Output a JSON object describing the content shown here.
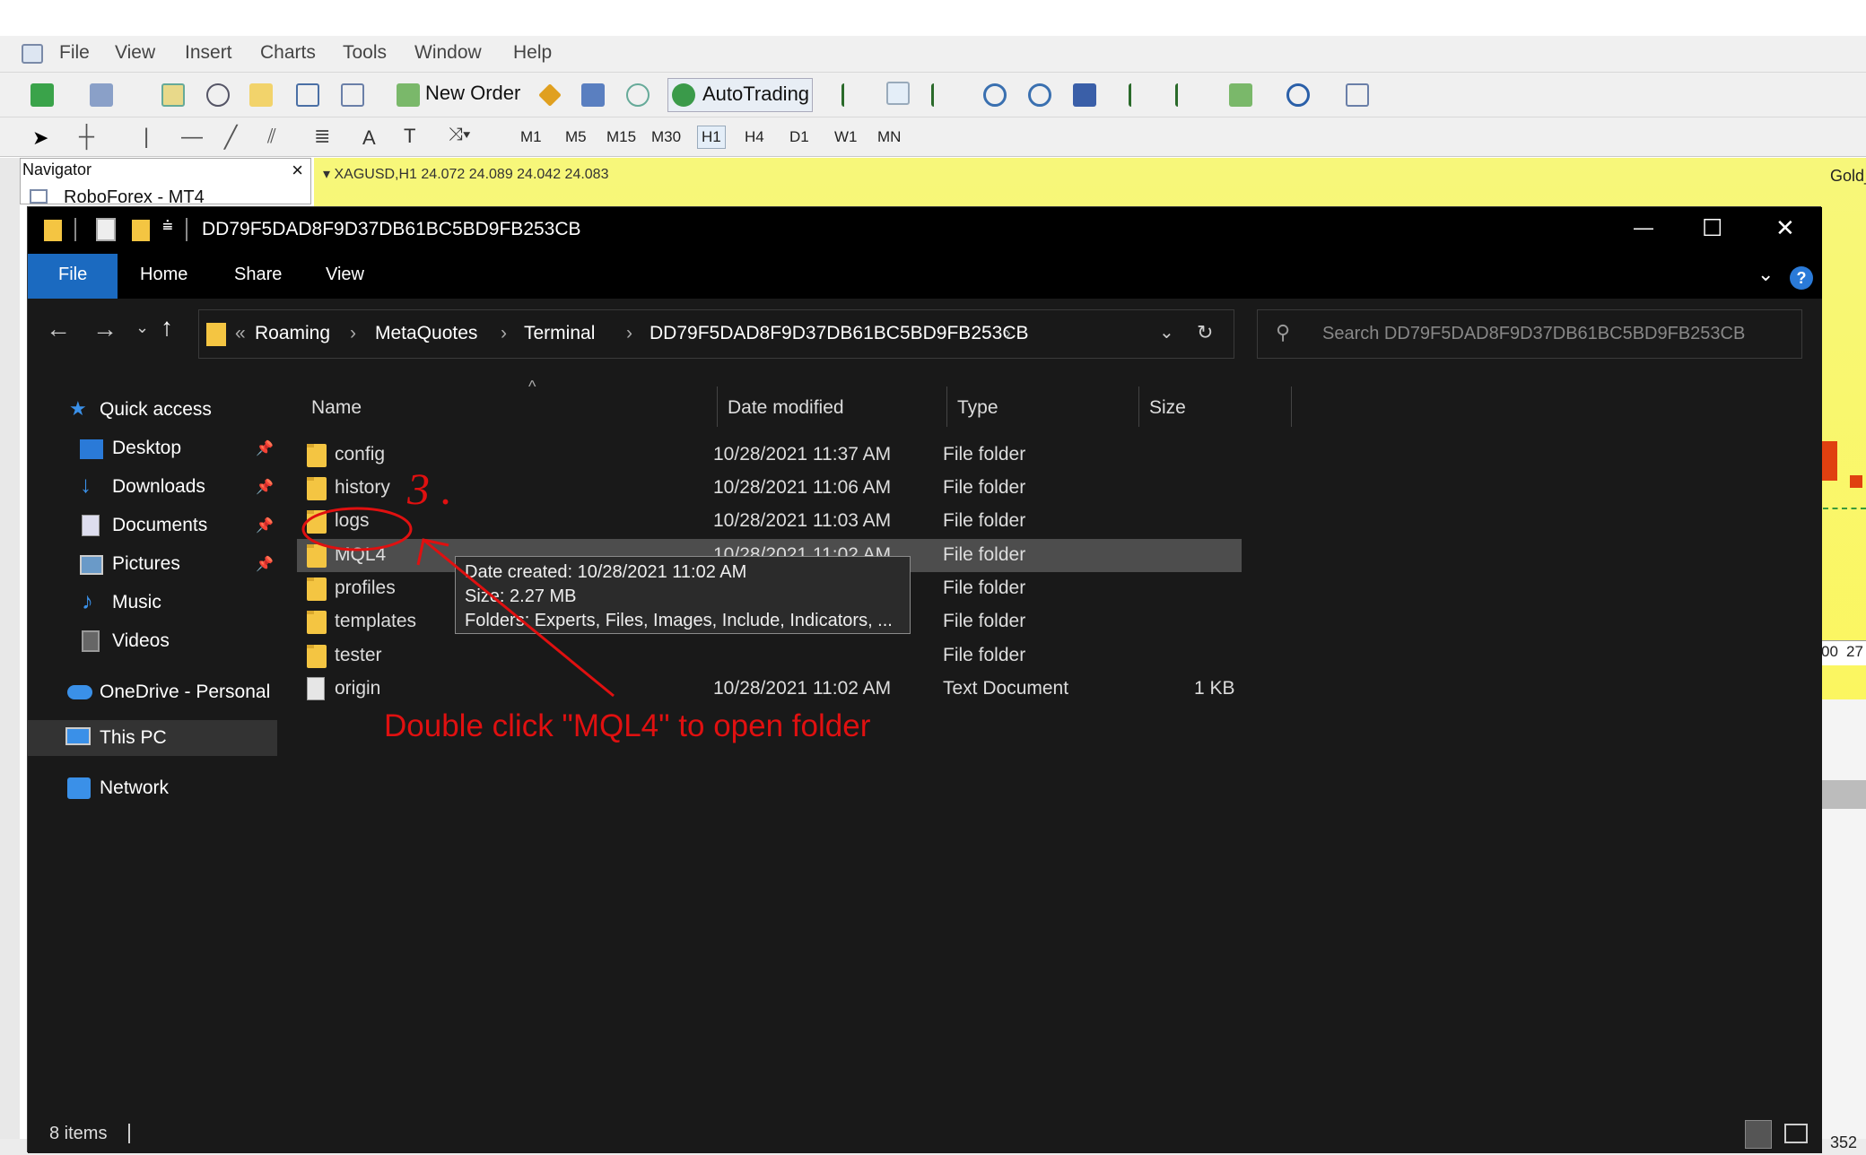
{
  "mt4": {
    "menu": [
      "File",
      "View",
      "Insert",
      "Charts",
      "Tools",
      "Window",
      "Help"
    ],
    "toolbar": {
      "new_order": "New Order",
      "autotrading": "AutoTrading"
    },
    "timeframes": [
      "M1",
      "M5",
      "M15",
      "M30",
      "H1",
      "H4",
      "D1",
      "W1",
      "MN"
    ],
    "selected_timeframe": "H1",
    "navigator": {
      "title": "Navigator",
      "close": "×",
      "item": "RoboForex - MT4"
    },
    "chart_header": "▾ XAGUSD,H1  24.072 24.089 24.042 24.083",
    "chart_symbol_right": "Gold_",
    "right_axis_values": [
      "00",
      "27"
    ],
    "bottom_right_value": "352",
    "colors": {
      "chart_bg": "#fff64a"
    }
  },
  "explorer": {
    "title": "DD79F5DAD8F9D37DB61BC5BD9FB253CB",
    "window_controls": {
      "minimize": "—",
      "maximize": "☐",
      "close": "✕"
    },
    "ribbon_tabs": [
      "File",
      "Home",
      "Share",
      "View"
    ],
    "breadcrumb": [
      "«",
      "Roaming",
      "MetaQuotes",
      "Terminal",
      "DD79F5DAD8F9D37DB61BC5BD9FB253CB"
    ],
    "search_placeholder": "Search DD79F5DAD8F9D37DB61BC5BD9FB253CB",
    "sidebar": [
      {
        "label": "Quick access",
        "icon": "star-icon",
        "pinned": false
      },
      {
        "label": "Desktop",
        "icon": "desktop-icon",
        "pinned": true
      },
      {
        "label": "Downloads",
        "icon": "download-arrow-icon",
        "pinned": true
      },
      {
        "label": "Documents",
        "icon": "documents-icon",
        "pinned": true
      },
      {
        "label": "Pictures",
        "icon": "pictures-icon",
        "pinned": true
      },
      {
        "label": "Music",
        "icon": "music-note-icon",
        "pinned": false
      },
      {
        "label": "Videos",
        "icon": "videos-icon",
        "pinned": false
      },
      {
        "label": "OneDrive - Personal",
        "icon": "cloud-icon",
        "pinned": false
      },
      {
        "label": "This PC",
        "icon": "computer-icon",
        "pinned": false,
        "selected": true
      },
      {
        "label": "Network",
        "icon": "network-icon",
        "pinned": false
      }
    ],
    "columns": [
      "Name",
      "Date modified",
      "Type",
      "Size"
    ],
    "files": [
      {
        "name": "config",
        "date": "10/28/2021 11:37 AM",
        "type": "File folder",
        "size": "",
        "kind": "folder"
      },
      {
        "name": "history",
        "date": "10/28/2021 11:06 AM",
        "type": "File folder",
        "size": "",
        "kind": "folder"
      },
      {
        "name": "logs",
        "date": "10/28/2021 11:03 AM",
        "type": "File folder",
        "size": "",
        "kind": "folder"
      },
      {
        "name": "MQL4",
        "date": "10/28/2021 11:02 AM",
        "type": "File folder",
        "size": "",
        "kind": "folder",
        "selected": true
      },
      {
        "name": "profiles",
        "date": "",
        "type": "File folder",
        "size": "",
        "kind": "folder"
      },
      {
        "name": "templates",
        "date": "",
        "type": "File folder",
        "size": "",
        "kind": "folder"
      },
      {
        "name": "tester",
        "date": "",
        "type": "File folder",
        "size": "",
        "kind": "folder"
      },
      {
        "name": "origin",
        "date": "10/28/2021 11:02 AM",
        "type": "Text Document",
        "size": "1 KB",
        "kind": "file"
      }
    ],
    "tooltip": [
      "Date created: 10/28/2021 11:02 AM",
      "Size: 2.27 MB",
      "Folders: Experts, Files, Images, Include, Indicators, ..."
    ],
    "status_items": "8 items",
    "colors": {
      "selection": "#4d4d4d",
      "file_tab": "#1b6ac0",
      "folder": "#f4c542"
    }
  },
  "annotation": {
    "step_number": "3 .",
    "instruction": "Double click \"MQL4\" to open folder",
    "color": "#e01010"
  }
}
